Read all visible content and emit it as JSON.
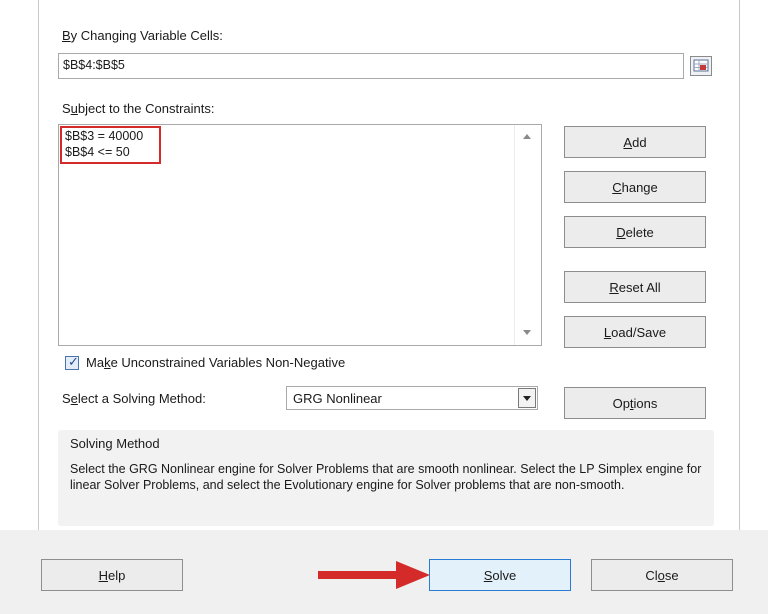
{
  "variable_cells": {
    "label_underline": "B",
    "label_rest": "y Changing Variable Cells:",
    "value": "$B$4:$B$5"
  },
  "constraints": {
    "label_pre": "S",
    "label_underline": "u",
    "label_rest": "bject to the Constraints:",
    "items": [
      "$B$3 = 40000",
      "$B$4 <= 50"
    ]
  },
  "side_buttons": {
    "add": {
      "pre": "",
      "ul": "A",
      "post": "dd"
    },
    "change": {
      "pre": "",
      "ul": "C",
      "post": "hange"
    },
    "delete": {
      "pre": "",
      "ul": "D",
      "post": "elete"
    },
    "reset_all": {
      "pre": "",
      "ul": "R",
      "post": "eset All"
    },
    "load_save": {
      "pre": "",
      "ul": "L",
      "post": "oad/Save"
    },
    "options": {
      "pre": "Op",
      "ul": "t",
      "post": "ions"
    }
  },
  "non_negative": {
    "checked": true,
    "check_glyph": "✓",
    "pre": "Ma",
    "ul": "k",
    "post": "e Unconstrained Variables Non-Negative"
  },
  "solving_method": {
    "pre": "S",
    "ul": "e",
    "post": "lect a Solving Method:",
    "selected": "GRG Nonlinear"
  },
  "method_info": {
    "title": "Solving Method",
    "description": "Select the GRG Nonlinear engine for Solver Problems that are smooth nonlinear. Select the LP Simplex engine for linear Solver Problems, and select the Evolutionary engine for Solver problems that are non-smooth."
  },
  "footer_buttons": {
    "help": {
      "pre": "",
      "ul": "H",
      "post": "elp"
    },
    "solve": {
      "pre": "",
      "ul": "S",
      "post": "olve"
    },
    "close": {
      "pre": "Cl",
      "ul": "o",
      "post": "se"
    }
  },
  "colors": {
    "highlight": "#d42a2a",
    "arrow": "#d42a2a",
    "primary_border": "#2a7bd3",
    "primary_fill": "#e3f1fb"
  }
}
